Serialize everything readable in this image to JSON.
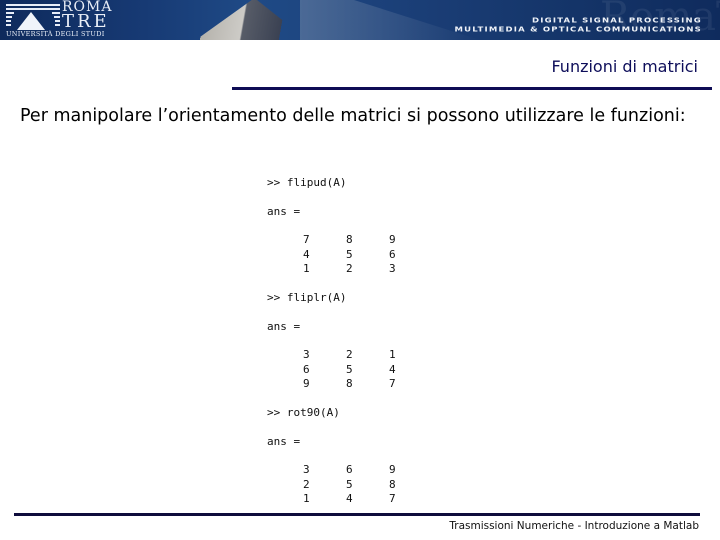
{
  "header": {
    "logo": {
      "name_line1": "ROMA",
      "name_line2": "TRE",
      "subtitle": "UNIVERSITÀ DEGLI STUDI"
    },
    "banner_line1": "DIGITAL SIGNAL PROCESSING",
    "banner_line2": "MULTIMEDIA & OPTICAL  COMMUNICATIONS",
    "watermark": "RomaTre"
  },
  "slide": {
    "title": "Funzioni di matrici",
    "intro": "Per manipolare l’orientamento delle matrici si possono utilizzare le funzioni:"
  },
  "code_blocks": [
    {
      "command": ">> flipud(A)",
      "result_label": "ans =",
      "matrix": [
        [
          "7",
          "8",
          "9"
        ],
        [
          "4",
          "5",
          "6"
        ],
        [
          "1",
          "2",
          "3"
        ]
      ]
    },
    {
      "command": ">> fliplr(A)",
      "result_label": "ans =",
      "matrix": [
        [
          "3",
          "2",
          "1"
        ],
        [
          "6",
          "5",
          "4"
        ],
        [
          "9",
          "8",
          "7"
        ]
      ]
    },
    {
      "command": ">> rot90(A)",
      "result_label": "ans =",
      "matrix": [
        [
          "3",
          "6",
          "9"
        ],
        [
          "2",
          "5",
          "8"
        ],
        [
          "1",
          "4",
          "7"
        ]
      ]
    }
  ],
  "footer": {
    "text": "Trasmissioni Numeriche - Introduzione a Matlab"
  },
  "colors": {
    "banner_blue": "#173a74",
    "title_navy": "#0e0e5a",
    "rule_navy": "#0e0c55"
  }
}
